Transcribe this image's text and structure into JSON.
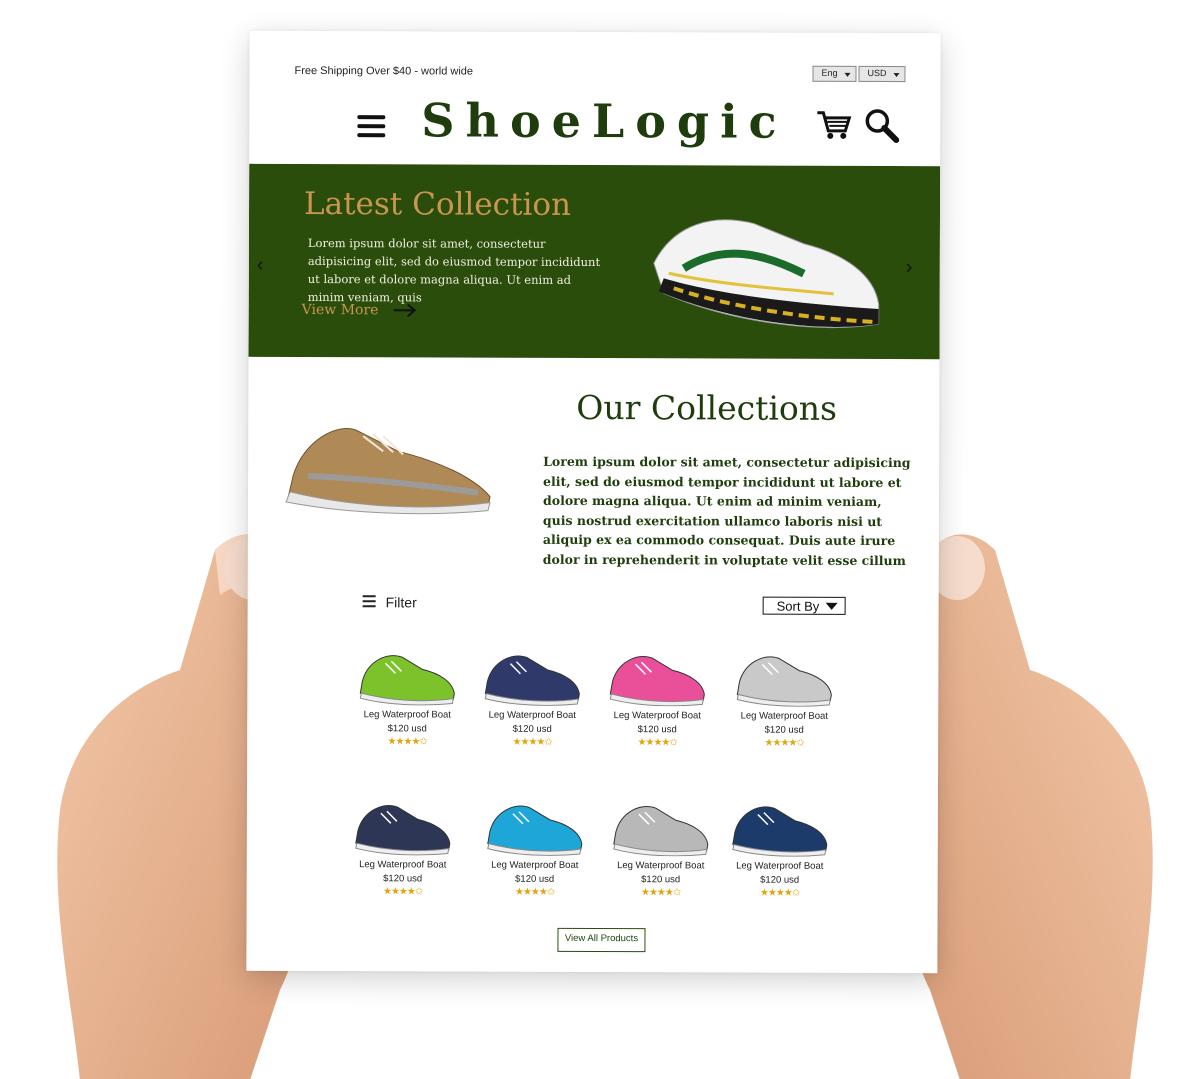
{
  "colors": {
    "brand_green": "#2a4d0c",
    "accent_gold": "#c8964f",
    "star": "#e2a512"
  },
  "topbar": {
    "shipping": "Free Shipping Over $40 - world wide",
    "language": "Eng",
    "currency": "USD"
  },
  "header": {
    "logo": "ShoeLogic",
    "icons": [
      "menu-icon",
      "cart-icon",
      "search-icon"
    ]
  },
  "hero": {
    "title": "Latest Collection",
    "text": "Lorem ipsum dolor sit amet, consectetur adipisicing elit, sed do eiusmod tempor incididunt ut labore et dolore magna aliqua. Ut enim ad minim veniam, quis",
    "cta": "View More"
  },
  "collections": {
    "title": "Our Collections",
    "text": "Lorem ipsum dolor sit amet, consectetur adipisicing elit, sed do eiusmod tempor incididunt ut labore et dolore magna aliqua. Ut enim ad minim veniam, quis nostrud exercitation ullamco laboris nisi ut aliquip ex ea commodo consequat. Duis aute irure dolor in reprehenderit in voluptate velit esse cillum dolore eu fugiat nulla pariatur. Excepteur sint occaeca"
  },
  "toolbar": {
    "filter": "Filter",
    "sort": "Sort By"
  },
  "products": [
    {
      "name": "Leg Waterproof Boat",
      "price": "$120 usd",
      "stars": "★★★★✩",
      "color": "#7cc22a"
    },
    {
      "name": "Leg Waterproof Boat",
      "price": "$120 usd",
      "stars": "★★★★✩",
      "color": "#2f3a6b"
    },
    {
      "name": "Leg Waterproof Boat",
      "price": "$120 usd",
      "stars": "★★★★✩",
      "color": "#ea4f9a"
    },
    {
      "name": "Leg Waterproof Boat",
      "price": "$120 usd",
      "stars": "★★★★✩",
      "color": "#c9c9c9"
    },
    {
      "name": "Leg Waterproof Boat",
      "price": "$120 usd",
      "stars": "★★★★✩",
      "color": "#2e3656"
    },
    {
      "name": "Leg Waterproof Boat",
      "price": "$120 usd",
      "stars": "★★★★✩",
      "color": "#1fa6d9"
    },
    {
      "name": "Leg Waterproof Boat",
      "price": "$120 usd",
      "stars": "★★★★✩",
      "color": "#b8b8b8"
    },
    {
      "name": "Leg Waterproof Boat",
      "price": "$120 usd",
      "stars": "★★★★✩",
      "color": "#1c3a6a"
    }
  ],
  "footer": {
    "view_all": "View All Products"
  }
}
